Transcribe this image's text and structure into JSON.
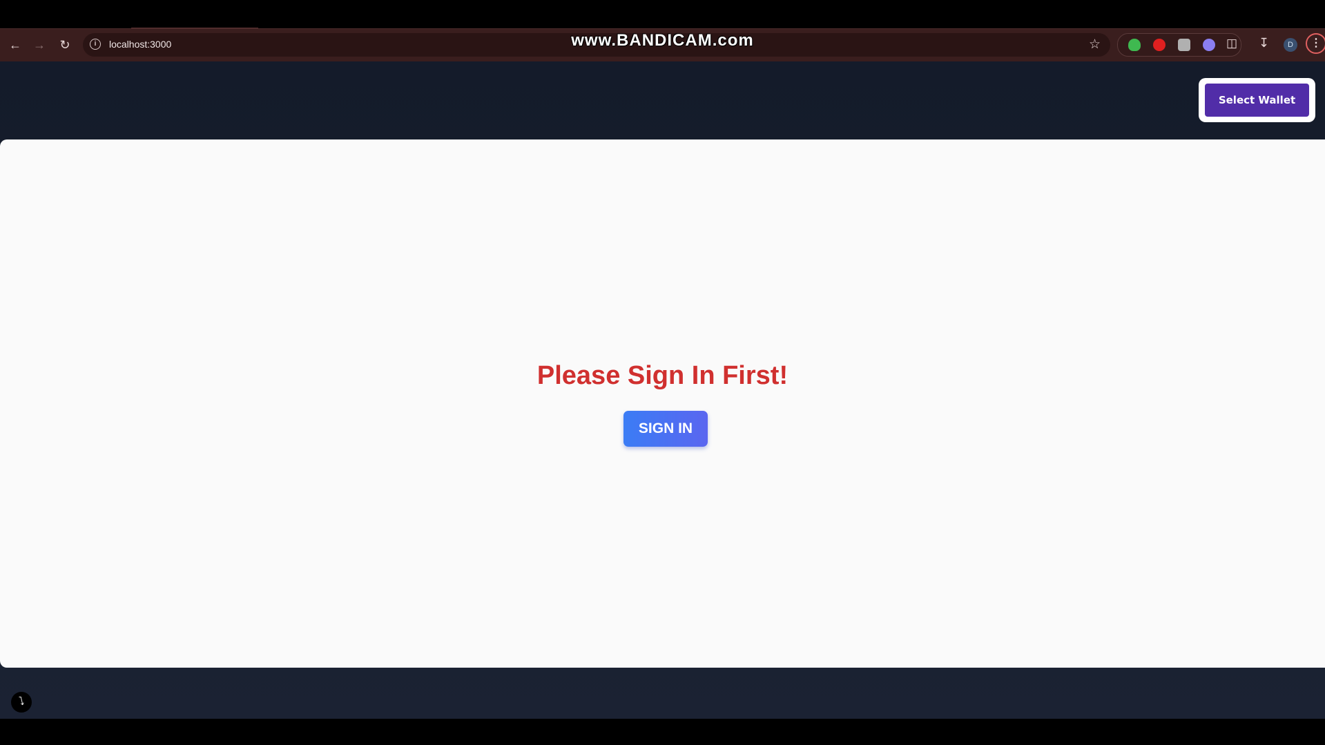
{
  "browser": {
    "url": "localhost:3000",
    "watermark": "www.BANDICAM.com",
    "profile_initial": "D",
    "icons": {
      "back": "arrow-left-icon",
      "forward": "arrow-right-icon",
      "reload": "reload-icon",
      "site_info": "info-icon",
      "bookmark": "star-icon",
      "extensions": "puzzle-icon",
      "downloads": "download-icon",
      "menu": "kebab-menu-icon"
    },
    "extension_colors": [
      "#3fb950",
      "#e02020",
      "#b0b0b0",
      "#8a7ef0"
    ]
  },
  "header": {
    "wallet_button_label": "Select Wallet",
    "wallet_button_color": "#512da8"
  },
  "main": {
    "headline": "Please Sign In First!",
    "headline_color": "#d0302f",
    "signin_button_label": "SIGN IN"
  },
  "footer": {
    "dev_tools_icon": "lightning-bolt-icon"
  }
}
